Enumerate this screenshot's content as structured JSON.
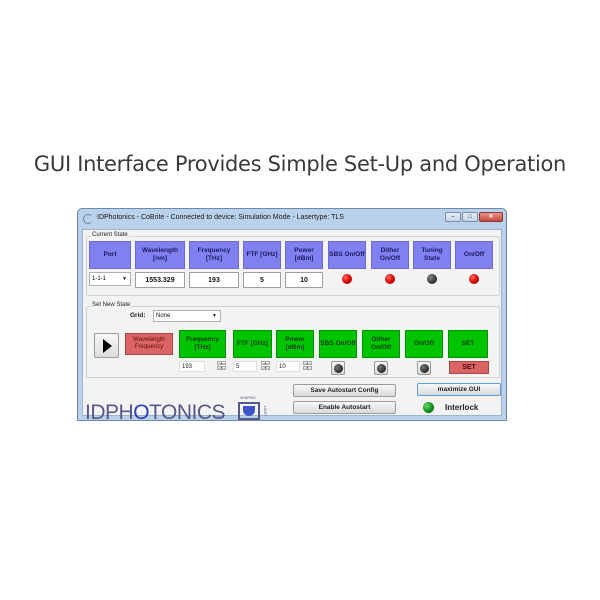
{
  "headline": "GUI Interface Provides Simple Set-Up and Operation",
  "window": {
    "title": "IDPhotonics - CoBrite - Connected to device: Simulation Mode - Lasertype: TLS",
    "controls": {
      "minimize": "–",
      "maximize": "□",
      "close": "✕"
    }
  },
  "current_state": {
    "label": "Current State",
    "headers": {
      "port": "Port",
      "wavelength": "Wavelength [nm]",
      "frequency": "Frequency [THz]",
      "ftf": "FTF [GHz]",
      "power": "Power [dBm]",
      "sbs": "SBS On/Off",
      "dither": "Dither On/Off",
      "tuning": "Tuning State",
      "onoff": "On/Off"
    },
    "values": {
      "port": "1-1-1",
      "wavelength": "1553.329",
      "frequency": "193",
      "ftf": "5",
      "power": "10"
    },
    "leds": {
      "sbs": "red",
      "dither": "red",
      "tuning": "dark",
      "onoff": "red"
    }
  },
  "set_new_state": {
    "label": "Set New State",
    "grid_label": "Grid:",
    "grid_value": "None",
    "mode_button": "Wavelength Frequency",
    "buttons": {
      "frequency": "Frequency [THz]",
      "ftf": "FTF [GHz]",
      "power": "Power [dBm]",
      "sbs": "SBS On/Off",
      "dither": "Dither On/Off",
      "onoff": "On/Off",
      "set": "SET"
    },
    "inputs": {
      "frequency": "193",
      "ftf": "5",
      "power": "10"
    },
    "set_button": "SET"
  },
  "footer": {
    "logo_text_1": "IDPH",
    "logo_o": "O",
    "logo_text_2": "TONICS",
    "logo_small_gmbh": "GmbH",
    "logo_small_shaping": "SHAPING",
    "logo_small_light": "LIGHT",
    "save_autostart": "Save Autostart Config",
    "enable_autostart": "Enable Autostart",
    "maximize_gui": "maximize GUI",
    "interlock_label": "Interlock",
    "interlock_state": "green"
  }
}
